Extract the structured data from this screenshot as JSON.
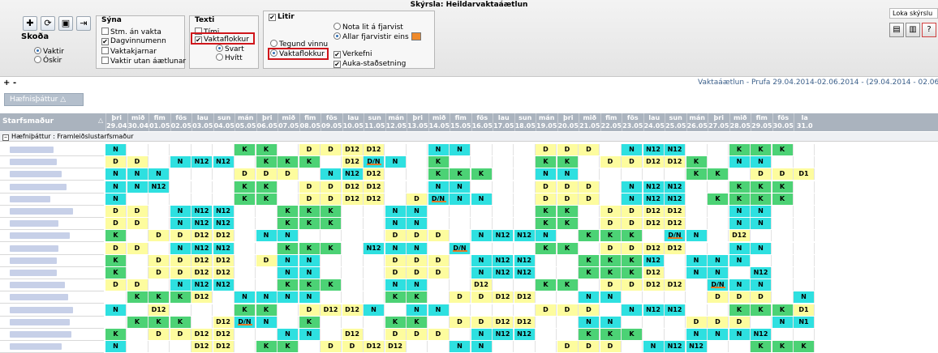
{
  "window": {
    "title": "Skýrsla: Heildarvaktaáætlun"
  },
  "toolbar": {
    "icons": [
      "add-icon",
      "refresh-icon",
      "preview-icon",
      "export-icon"
    ]
  },
  "skoda": {
    "title": "Skoða",
    "options": [
      "Vaktir",
      "Óskir"
    ],
    "selected": 0
  },
  "syna": {
    "title": "Sýna",
    "options": [
      {
        "label": "Stm. án vakta",
        "checked": false
      },
      {
        "label": "Dagvinnumenn",
        "checked": true
      },
      {
        "label": "Vaktakjarnar",
        "checked": false
      },
      {
        "label": "Vaktir utan áætlunar",
        "checked": false
      }
    ]
  },
  "texti": {
    "title": "Texti",
    "timi": {
      "label": "Tími",
      "checked": false
    },
    "vaktaflokkur": {
      "label": "Vaktaflokkur",
      "checked": true
    },
    "svart": "Svart",
    "hvitt": "Hvítt",
    "selected": "svart"
  },
  "litir": {
    "title": "Litir",
    "checked": true,
    "tegund": "Tegund vinnu",
    "vaktaflokkur": "Vaktaflokkur",
    "selected": "vaktaflokkur",
    "nota": "Nota lit á fjarvist",
    "allar": "Allar fjarvistir eins",
    "verkefni": {
      "label": "Verkefni",
      "checked": true
    },
    "auka": {
      "label": "Auka-staðsetning",
      "checked": true
    },
    "fjarvist_color": "#ef8a2b"
  },
  "loka": "Loka skýrslu",
  "controls": {
    "plus": "+",
    "minus": "-"
  },
  "period": "Vaktaáætlun - Prufa 29.04.2014-02.06.2014 - (29.04.2014 - 02.06.2014)",
  "group_button": "Hæfnisþáttur",
  "header": {
    "title": "Starfsmaður"
  },
  "group_row": "Hæfniþáttur : Framleiðslustarfsmaður",
  "days": [
    [
      "þri",
      "29.04"
    ],
    [
      "mið",
      "30.04"
    ],
    [
      "fim",
      "01.05"
    ],
    [
      "fös",
      "02.05"
    ],
    [
      "lau",
      "03.05"
    ],
    [
      "sun",
      "04.05"
    ],
    [
      "mán",
      "05.05"
    ],
    [
      "þri",
      "06.05"
    ],
    [
      "mið",
      "07.05"
    ],
    [
      "fim",
      "08.05"
    ],
    [
      "fös",
      "09.05"
    ],
    [
      "lau",
      "10.05"
    ],
    [
      "sun",
      "11.05"
    ],
    [
      "mán",
      "12.05"
    ],
    [
      "þri",
      "13.05"
    ],
    [
      "mið",
      "14.05"
    ],
    [
      "fim",
      "15.05"
    ],
    [
      "fös",
      "16.05"
    ],
    [
      "lau",
      "17.05"
    ],
    [
      "sun",
      "18.05"
    ],
    [
      "mán",
      "19.05"
    ],
    [
      "þri",
      "20.05"
    ],
    [
      "mið",
      "21.05"
    ],
    [
      "fim",
      "22.05"
    ],
    [
      "fös",
      "23.05"
    ],
    [
      "lau",
      "24.05"
    ],
    [
      "sun",
      "25.05"
    ],
    [
      "mán",
      "26.05"
    ],
    [
      "þri",
      "27.05"
    ],
    [
      "mið",
      "28.05"
    ],
    [
      "fim",
      "29.05"
    ],
    [
      "fös",
      "30.05"
    ],
    [
      "la",
      "31.0"
    ]
  ],
  "rows": [
    [
      [
        "N",
        "Y"
      ],
      "",
      "",
      "",
      "",
      "",
      "K",
      "K",
      "",
      "D",
      "D",
      "D12",
      "D12",
      "",
      "",
      "N",
      "N",
      "",
      "",
      "",
      "D",
      "D",
      "D",
      "",
      "N",
      "N12",
      "N12",
      "",
      "",
      "K",
      "K",
      "K",
      ""
    ],
    [
      [
        "D",
        "Y"
      ],
      "D",
      "",
      "N",
      "N12",
      "N12",
      "",
      "K",
      "K",
      "K",
      "",
      "D12",
      [
        "D/N",
        "T"
      ],
      "N",
      "",
      "K",
      "",
      "",
      "",
      "",
      "K",
      "K",
      "",
      "D",
      "D",
      "D12",
      "D12",
      "K",
      "",
      "N",
      "N",
      "",
      ""
    ],
    [
      [
        "N",
        "Y"
      ],
      "N",
      "N",
      "",
      "",
      "",
      "D",
      "D",
      "D",
      "",
      "N",
      "N12",
      "D12",
      "",
      "",
      "K",
      "K",
      "K",
      "",
      "",
      "N",
      "N",
      "",
      "",
      "",
      "",
      "",
      "K",
      "K",
      "",
      "D",
      "D",
      "D1"
    ],
    [
      [
        "N",
        "Y"
      ],
      "N",
      "N12",
      "",
      "",
      "",
      "K",
      "K",
      "",
      "D",
      "D",
      "D12",
      "D12",
      "",
      "",
      "N",
      "N",
      "",
      "",
      "",
      "D",
      "D",
      "D",
      "",
      "N",
      "N12",
      "N12",
      "",
      "",
      "K",
      "K",
      "K",
      ""
    ],
    [
      [
        "N",
        "Y"
      ],
      "",
      "",
      "",
      "",
      "",
      "K",
      "K",
      "",
      "D",
      "D",
      "D12",
      "D12",
      "",
      "D",
      [
        "D/N",
        "T"
      ],
      "N",
      "N",
      "",
      "",
      "D",
      "D",
      "D",
      "",
      "N",
      "N12",
      "N12",
      "",
      "K",
      "K",
      "K",
      "K",
      ""
    ],
    [
      [
        "D",
        "Y"
      ],
      "D",
      "",
      "N",
      "N12",
      "N12",
      "",
      "",
      "K",
      "K",
      "K",
      "",
      "",
      "N",
      "N",
      "",
      "",
      "",
      "",
      "",
      "K",
      "K",
      "",
      "D",
      "D",
      "D12",
      "D12",
      "",
      "",
      "N",
      "N",
      "",
      ""
    ],
    [
      [
        "D",
        "Y"
      ],
      "D",
      "",
      "N",
      "N12",
      "N12",
      "",
      "",
      "K",
      "K",
      "K",
      "",
      "",
      "N",
      "N",
      "",
      "",
      "",
      "",
      "",
      "K",
      "K",
      "",
      "D",
      "D",
      "D12",
      "D12",
      "",
      "",
      "N",
      "N",
      "",
      ""
    ],
    [
      [
        "K",
        "G"
      ],
      "",
      "D",
      "D",
      "D12",
      "D12",
      "",
      "N",
      "N",
      "",
      "",
      "",
      "",
      "D",
      "D",
      "D",
      "",
      "N",
      "N12",
      "N12",
      "N",
      "",
      "K",
      "K",
      "K",
      "",
      [
        "D/N",
        "T"
      ],
      "N",
      "",
      "D12",
      "",
      "",
      ""
    ],
    [
      [
        "D",
        "Y"
      ],
      "D",
      "",
      "N",
      "N12",
      "N12",
      "",
      "",
      "K",
      "K",
      "K",
      "",
      "N12",
      "N",
      "N",
      "",
      [
        "D/N",
        "T"
      ],
      "",
      "",
      "",
      "K",
      "K",
      "",
      "D",
      "D",
      "D12",
      "D12",
      "",
      "",
      "N",
      "N",
      "",
      ""
    ],
    [
      [
        "K",
        "G"
      ],
      "",
      "D",
      "D",
      "D12",
      "D12",
      "",
      "D",
      "N",
      "N",
      "",
      "",
      "",
      "D",
      "D",
      "D",
      "",
      "N",
      "N12",
      "N12",
      "",
      "",
      "K",
      "K",
      "K",
      "N12",
      "",
      "N",
      "N",
      "N",
      "",
      "",
      ""
    ],
    [
      [
        "K",
        "G"
      ],
      "",
      "D",
      "D",
      "D12",
      "D12",
      "",
      "",
      "N",
      "N",
      "",
      "",
      "",
      "D",
      "D",
      "D",
      "",
      "N",
      "N12",
      "N12",
      "",
      "",
      "K",
      "K",
      "K",
      "D12",
      "",
      "N",
      "N",
      "",
      "N12",
      "",
      ""
    ],
    [
      [
        "D",
        "Y"
      ],
      "D",
      "",
      "N",
      "N12",
      "N12",
      "",
      "",
      "K",
      "K",
      "K",
      "",
      "",
      "N",
      "N",
      "",
      "",
      "D12",
      "",
      "",
      "K",
      "K",
      "",
      "D",
      "D",
      "D12",
      "D12",
      "",
      "D/N",
      "N",
      "N",
      "",
      ""
    ],
    [
      "",
      "K",
      "K",
      "K",
      "D12",
      "",
      "N",
      "N",
      "N",
      "N",
      "",
      "",
      "",
      "K",
      "K",
      "",
      "D",
      "D",
      "D12",
      "D12",
      "",
      "",
      "N",
      "N",
      "",
      "",
      "",
      "",
      "D",
      "D",
      "D",
      "",
      "N"
    ],
    [
      [
        "N",
        "Y"
      ],
      "",
      "D12",
      "",
      "",
      "",
      "K",
      "K",
      "",
      "D",
      "D12",
      "D12",
      "N",
      "",
      "N",
      "N",
      "",
      "",
      "",
      "",
      "D",
      "D",
      "D",
      "",
      "N",
      "N12",
      "N12",
      "",
      "",
      "K",
      "K",
      "K",
      "D1"
    ],
    [
      "",
      "K",
      "K",
      "K",
      "",
      "D12",
      [
        "D/N",
        "T"
      ],
      "N",
      "",
      "K",
      "",
      "",
      "",
      "K",
      "K",
      "",
      "D",
      "D",
      "D12",
      "D12",
      "",
      "",
      "N",
      "N",
      "",
      "",
      "",
      "D",
      "D",
      "D",
      "",
      "N",
      "N1"
    ],
    [
      [
        "K",
        "G"
      ],
      "",
      "D",
      "D",
      "D12",
      "D12",
      "",
      "",
      "N",
      "N",
      "",
      "D12",
      "",
      "D",
      "D",
      "D",
      "",
      "N",
      "N12",
      "N12",
      "",
      "",
      "K",
      "K",
      "K",
      "",
      "",
      "N",
      "N",
      "N",
      "N12",
      "",
      ""
    ],
    [
      [
        "N",
        "Y"
      ],
      "",
      "",
      "",
      "D12",
      "D12",
      "",
      "K",
      "K",
      "",
      "D",
      "D",
      "D12",
      "D12",
      "",
      "",
      "N",
      "N",
      "",
      "",
      "",
      "D",
      "D",
      "D",
      "",
      "N",
      "N12",
      "N12",
      "",
      "",
      "K",
      "K",
      "K"
    ]
  ]
}
